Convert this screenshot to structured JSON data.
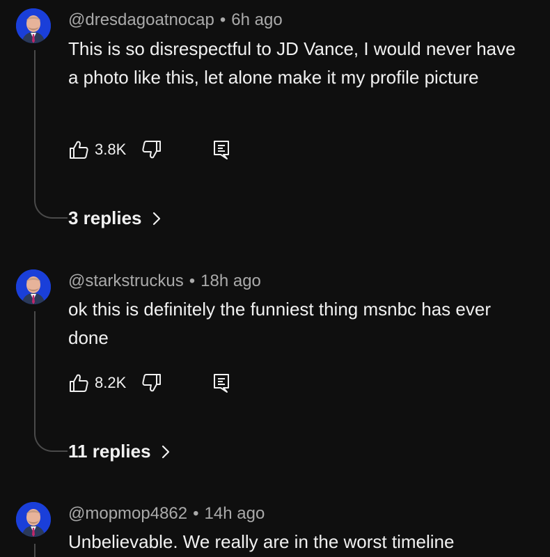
{
  "comments": [
    {
      "handle": "@dresdagoatnocap",
      "time": "6h ago",
      "text": "This is so disrespectful to JD Vance, I would never have a photo like this, let alone make it my profile picture",
      "likes": "3.8K",
      "replies_label": "3 replies"
    },
    {
      "handle": "@starkstruckus",
      "time": "18h ago",
      "text": "ok this is definitely the funniest thing msnbc has ever done",
      "likes": "8.2K",
      "replies_label": "11 replies"
    },
    {
      "handle": "@mopmop4862",
      "time": "14h ago",
      "text": "Unbelievable. We really are in the worst timeline"
    }
  ],
  "meta_separator": "•",
  "icons": {
    "like": "thumbs-up-icon",
    "dislike": "thumbs-down-icon",
    "reply": "reply-comment-icon",
    "chevron": "chevron-right-icon"
  },
  "colors": {
    "background": "#0f0f0f",
    "avatar_bg": "#1a3fd9",
    "muted_text": "#aaaaaa",
    "thread_line": "#4a4a4a"
  }
}
